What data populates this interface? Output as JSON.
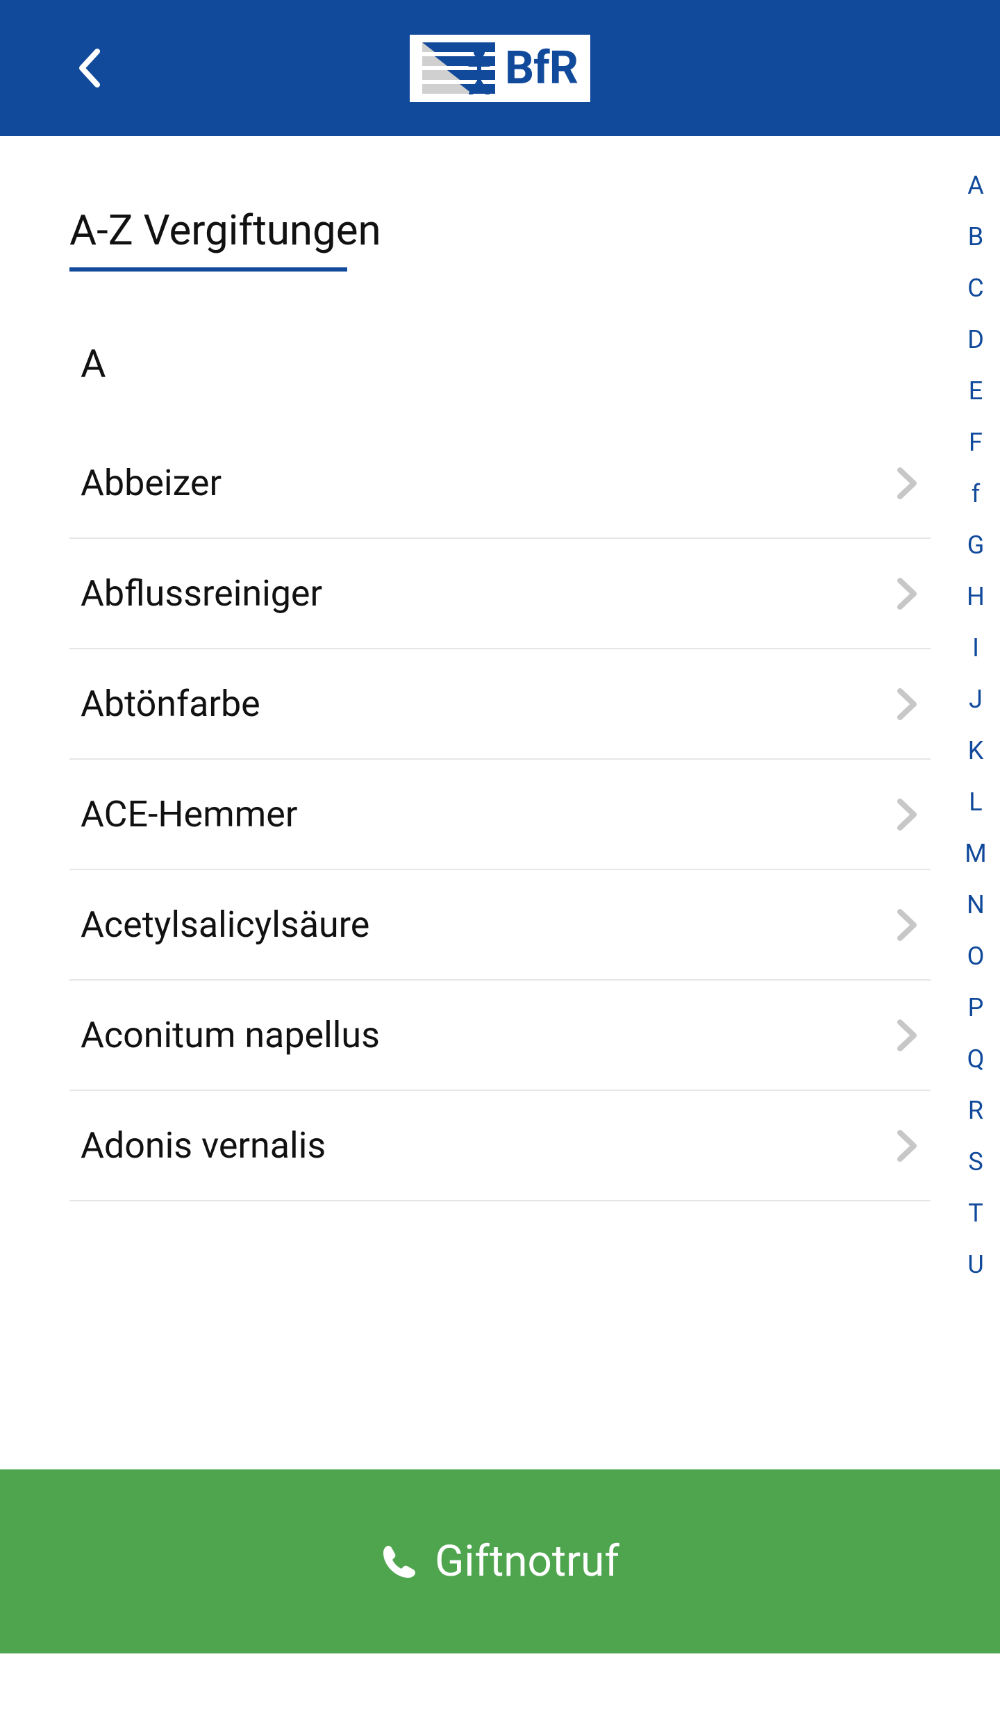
{
  "header": {
    "logo_text": "BfR"
  },
  "page": {
    "title": "A-Z Vergiftungen",
    "section_letter": "A"
  },
  "items": [
    {
      "label": "Abbeizer"
    },
    {
      "label": "Abflussreiniger"
    },
    {
      "label": "Abtönfarbe"
    },
    {
      "label": "ACE-Hemmer"
    },
    {
      "label": "Acetylsalicylsäure"
    },
    {
      "label": "Aconitum napellus"
    },
    {
      "label": "Adonis vernalis"
    }
  ],
  "alpha_index": [
    "A",
    "B",
    "C",
    "D",
    "E",
    "F",
    "f",
    "G",
    "H",
    "I",
    "J",
    "K",
    "L",
    "M",
    "N",
    "O",
    "P",
    "Q",
    "R",
    "S",
    "T",
    "U"
  ],
  "footer": {
    "emergency_label": "Giftnotruf"
  },
  "colors": {
    "primary": "#114a9b",
    "accent": "#4ea54e"
  }
}
